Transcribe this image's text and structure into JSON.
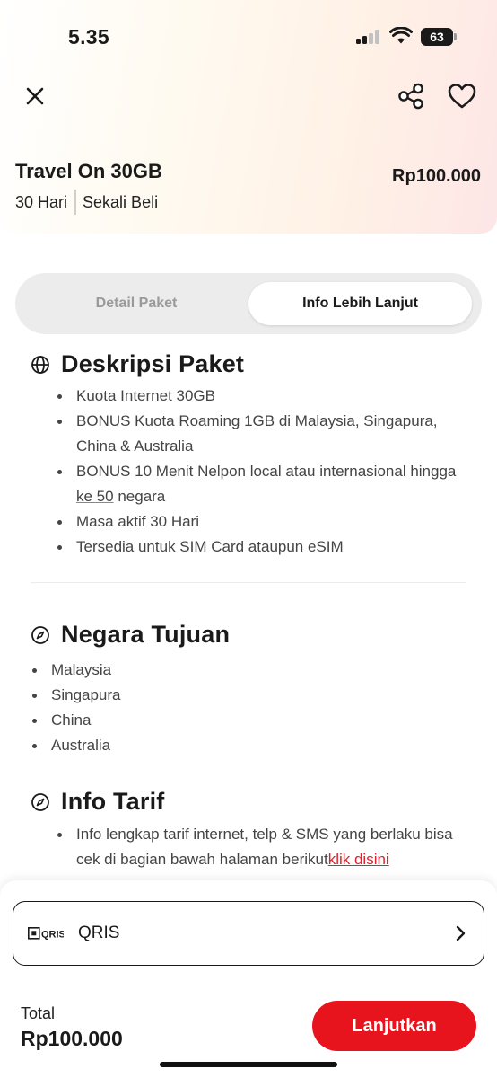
{
  "status_bar": {
    "time": "5.35",
    "battery": "63"
  },
  "package": {
    "title": "Travel On 30GB",
    "duration": "30 Hari",
    "purchase_type": "Sekali Beli",
    "price": "Rp100.000"
  },
  "tabs": [
    {
      "label": "Detail Paket",
      "active": false
    },
    {
      "label": "Info Lebih Lanjut",
      "active": true
    }
  ],
  "description": {
    "title": "Deskripsi Paket",
    "items": [
      "Kuota Internet 30GB",
      "BONUS Kuota Roaming 1GB di Malaysia, Singapura, China & Australia",
      "BONUS 10 Menit Nelpon local atau internasional",
      "hingga",
      "ke 50",
      "negara",
      "Masa aktif 30 Hari",
      "Tersedia untuk SIM Card ataupun eSIM"
    ]
  },
  "destinations": {
    "title": "Negara Tujuan",
    "items": [
      "Malaysia",
      "Singapura",
      "China",
      "Australia"
    ]
  },
  "tariff": {
    "title": "Info Tarif",
    "text": "Info lengkap tarif internet, telp & SMS yang berlaku bisa cek di bagian bawah halaman berikut",
    "link": "klik disini"
  },
  "payment": {
    "logo_text": "QRIS",
    "method": "QRIS"
  },
  "footer": {
    "total_label": "Total",
    "total_value": "Rp100.000",
    "cta_label": "Lanjutkan"
  },
  "colors": {
    "accent": "#e8141d",
    "link": "#e0202a"
  },
  "icons": [
    "close-icon",
    "share-icon",
    "heart-icon",
    "globe-icon",
    "compass-icon",
    "chevron-right-icon"
  ]
}
